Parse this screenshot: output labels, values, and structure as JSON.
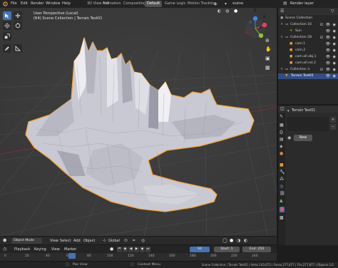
{
  "top_menu": [
    "File",
    "Edit",
    "Render",
    "Window",
    "Help"
  ],
  "workspaces": [
    "3D View Full",
    "Animation",
    "Compositing",
    "Default",
    "Game Logic",
    "Motion Tracking"
  ],
  "active_workspace": "Default",
  "scene_name": "scene",
  "render_layer": "Render layer",
  "viewport": {
    "perspective": "User Perspective (Local)",
    "collection_info": "(64) Scene Collection | Terrain Test01"
  },
  "gizmo": {
    "x": "X",
    "y": "Y",
    "z": "Z"
  },
  "outliner": {
    "root": "Scene Collection",
    "rows": [
      {
        "label": "Collection 16",
        "indent": 1,
        "selected": false
      },
      {
        "label": "Sun",
        "indent": 2,
        "selected": false
      },
      {
        "label": "Collection 28",
        "indent": 1,
        "selected": false
      },
      {
        "label": "cam.1",
        "indent": 2,
        "selected": false
      },
      {
        "label": "cam.2",
        "indent": 2,
        "selected": false
      },
      {
        "label": "cam.all.obj.1",
        "indent": 2,
        "selected": false
      },
      {
        "label": "cam.all.rot.2",
        "indent": 2,
        "selected": false
      },
      {
        "label": "Collection 3",
        "indent": 1,
        "selected": false
      },
      {
        "label": "Terrain Test01",
        "indent": 2,
        "selected": true
      }
    ]
  },
  "properties": {
    "object_name": "Terrain Test01",
    "new_button": "New"
  },
  "viewport_footer": {
    "mode": "Object Mode",
    "menus": [
      "View",
      "Select",
      "Add",
      "Object"
    ],
    "transform": "Global"
  },
  "timeline": {
    "menus": [
      "Playback",
      "Keying",
      "View",
      "Marker"
    ],
    "current_frame": "64",
    "start_label": "Start:",
    "start": "1",
    "end_label": "End:",
    "end": "250"
  },
  "timeline_ruler": [
    "0",
    "20",
    "40",
    "60",
    "80",
    "100",
    "120",
    "140",
    "160",
    "180",
    "200",
    "220",
    "240"
  ],
  "status": {
    "left": "Pan View",
    "middle": "Context Menu",
    "right": "Scene Collection | Terrain Test01 | Verts:143,672 | Faces:277,877 | Tris:277,877 | Objects:1/2"
  },
  "colors": {
    "accent": "#4772b3",
    "selection_outline": "#f5a33a",
    "mesh": "#c8c8d2",
    "grid": "#474747"
  }
}
